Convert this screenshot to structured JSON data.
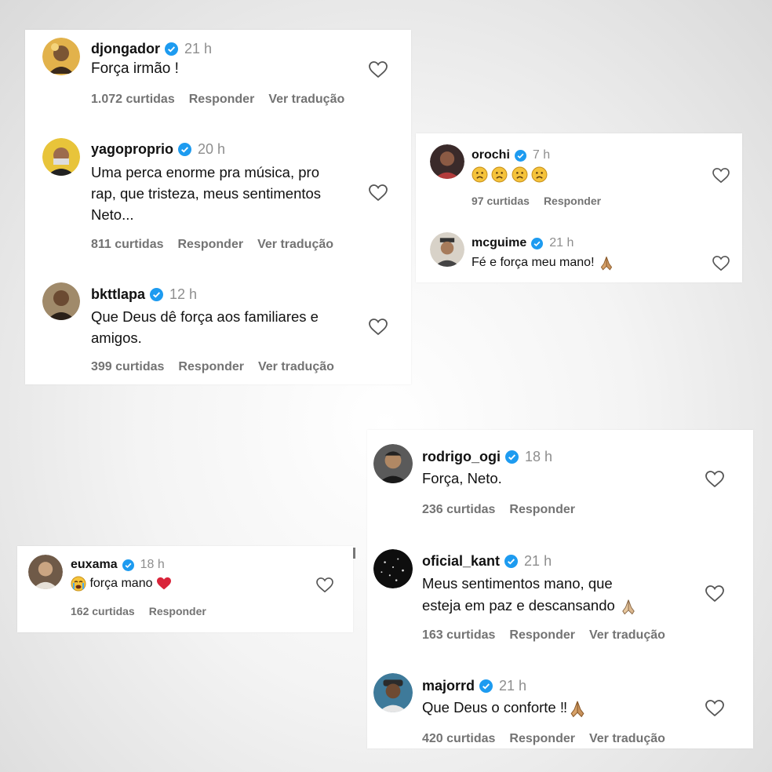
{
  "brand": {
    "verified_color": "#1d9bf0",
    "meta_color": "#737373"
  },
  "cards": {
    "a": {
      "comments": [
        {
          "user": "djongador",
          "time": "21 h",
          "text": "Força irmão !",
          "likes": "1.072 curtidas",
          "reply": "Responder",
          "translate": "Ver tradução"
        },
        {
          "user": "yagoproprio",
          "time": "20 h",
          "text_lines": [
            "Uma perca enorme pra música, pro",
            "rap, que tristeza, meus sentimentos",
            "Neto..."
          ],
          "likes": "811 curtidas",
          "reply": "Responder",
          "translate": "Ver tradução"
        },
        {
          "user": "bkttlapa",
          "time": "12 h",
          "text_lines": [
            "Que Deus dê força aos familiares e",
            "amigos."
          ],
          "likes": "399 curtidas",
          "reply": "Responder",
          "translate": "Ver tradução"
        }
      ]
    },
    "b": {
      "comments": [
        {
          "user": "orochi",
          "time": "7 h",
          "emoji": [
            "sad-face",
            "sad-face",
            "sad-face",
            "sad-face"
          ],
          "likes": "97 curtidas",
          "reply": "Responder"
        },
        {
          "user": "mcguime",
          "time": "21 h",
          "text": "Fé e força meu mano!",
          "emoji": "praying-hands",
          "likes": "",
          "reply": ""
        }
      ]
    },
    "c": {
      "comments": [
        {
          "user": "euxama",
          "time": "18 h",
          "emoji_lead": "crying-face",
          "text": "força mano",
          "emoji_trail": "red-heart",
          "likes": "162 curtidas",
          "reply": "Responder"
        }
      ]
    },
    "d": {
      "comments": [
        {
          "user": "rodrigo_ogi",
          "time": "18 h",
          "text": "Força, Neto.",
          "likes": "236 curtidas",
          "reply": "Responder"
        },
        {
          "user": "oficial_kant",
          "time": "21 h",
          "text_lines": [
            "Meus sentimentos mano, que",
            "esteja em paz e descansando"
          ],
          "emoji": "praying-hands",
          "likes": "163 curtidas",
          "reply": "Responder",
          "translate": "Ver tradução"
        },
        {
          "user": "majorrd",
          "time": "21 h",
          "text": "Que Deus o conforte ‼",
          "emoji": "praying-hands",
          "likes": "420 curtidas",
          "reply": "Responder",
          "translate": "Ver tradução"
        }
      ]
    }
  }
}
